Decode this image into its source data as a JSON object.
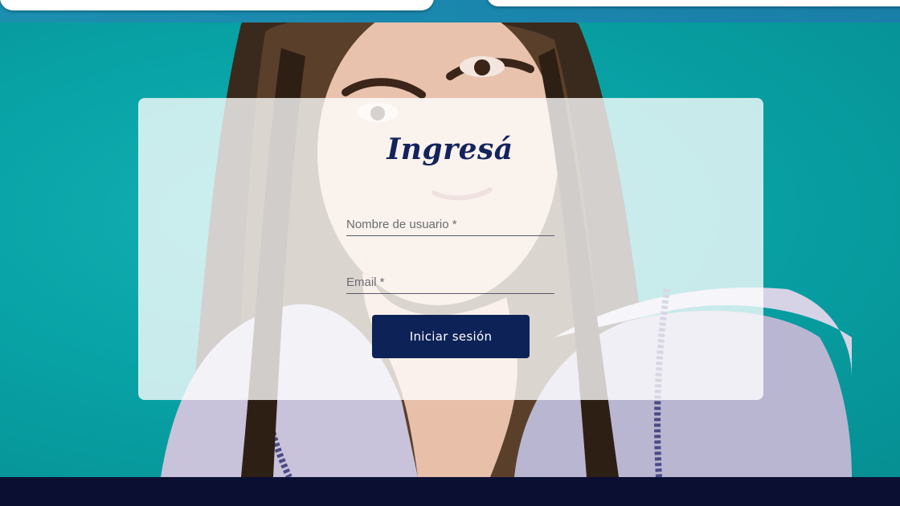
{
  "login": {
    "title": "Ingresá",
    "username_placeholder": "Nombre de usuario *",
    "email_placeholder": "Email *",
    "submit_label": "Iniciar sesión"
  },
  "colors": {
    "hero_background": "#0aa3a6",
    "primary_button": "#0d2257",
    "title_text": "#13235c",
    "footer": "#0b1033"
  }
}
